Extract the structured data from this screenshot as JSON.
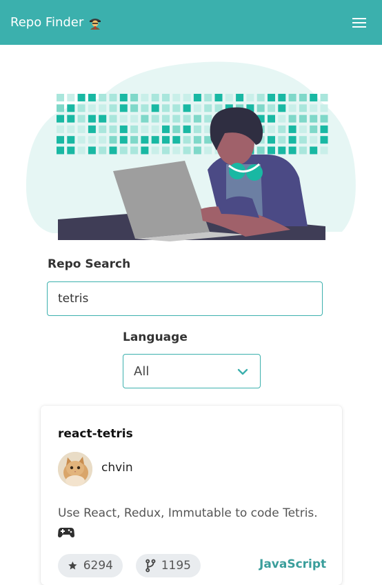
{
  "navbar": {
    "brand": "Repo Finder",
    "brand_icon": "detective-emoji",
    "menu_icon": "hamburger-icon",
    "color": "#3bb0ad"
  },
  "hero": {
    "illustration": "developer-at-laptop-illustration"
  },
  "search": {
    "label": "Repo Search",
    "value": "tetris"
  },
  "language_filter": {
    "label": "Language",
    "selected": "All"
  },
  "results": [
    {
      "name": "react-tetris",
      "owner": "chvin",
      "description": "Use React, Redux, Immutable to code Tetris.",
      "description_icon": "gamepad-emoji",
      "stars": "6294",
      "forks": "1195",
      "language": "JavaScript"
    }
  ],
  "colors": {
    "accent": "#3bb0ad",
    "language_text": "#3a9e9b",
    "pill_bg": "#e9ecef"
  }
}
